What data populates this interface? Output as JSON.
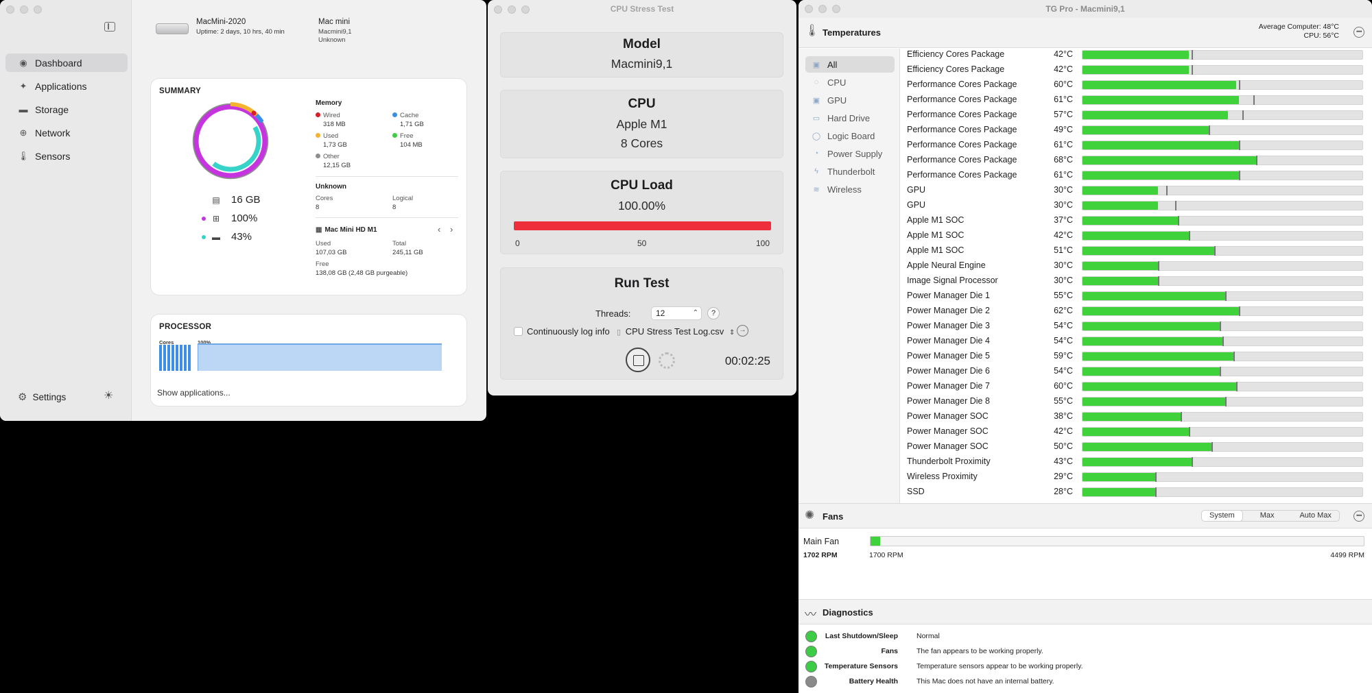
{
  "monitor": {
    "sidebar": {
      "items": [
        {
          "label": "Dashboard",
          "icon": "dashboard-icon",
          "selected": true
        },
        {
          "label": "Applications",
          "icon": "applications-icon",
          "selected": false
        },
        {
          "label": "Storage",
          "icon": "storage-icon",
          "selected": false
        },
        {
          "label": "Network",
          "icon": "network-icon",
          "selected": false
        },
        {
          "label": "Sensors",
          "icon": "sensors-icon",
          "selected": false
        }
      ],
      "settings_label": "Settings"
    },
    "device": {
      "name": "MacMini-2020",
      "uptime": "Uptime: 2 days, 10 hrs, 40 min",
      "model": "Mac mini",
      "identifier": "Macmini9,1",
      "extra": "Unknown"
    },
    "summary": {
      "title": "SUMMARY",
      "memory_title": "Memory",
      "memory": {
        "wired": {
          "label": "Wired",
          "value": "318 MB",
          "color": "#d81f26"
        },
        "cache": {
          "label": "Cache",
          "value": "1,71 GB",
          "color": "#3a8ee6"
        },
        "used": {
          "label": "Used",
          "value": "1,73 GB",
          "color": "#f2b431"
        },
        "free": {
          "label": "Free",
          "value": "104 MB",
          "color": "#3ccc45"
        },
        "other": {
          "label": "Other",
          "value": "12,15 GB",
          "color": "#8e8e8e"
        }
      },
      "cpu_title": "Unknown",
      "cores_label": "Cores",
      "cores_value": "8",
      "logical_label": "Logical",
      "logical_value": "8",
      "disk_title": "Mac Mini HD M1",
      "disk_used_label": "Used",
      "disk_used": "107,03 GB",
      "disk_total_label": "Total",
      "disk_total": "245,11 GB",
      "disk_free_label": "Free",
      "disk_free": "138,08 GB (2,48 GB purgeable)",
      "stat_memory": "16 GB",
      "stat_cpu": "100%",
      "stat_disk": "43%",
      "colors": {
        "cpu": "#c634e0",
        "disk": "#36d3c8"
      }
    },
    "processor": {
      "title": "PROCESSOR",
      "cores_label": "Cores",
      "percent_label": "100%",
      "show_apps": "Show applications..."
    }
  },
  "stress": {
    "title": "CPU Stress Test",
    "model_title": "Model",
    "model_value": "Macmini9,1",
    "cpu_title": "CPU",
    "cpu_value": "Apple M1",
    "cpu_cores": "8 Cores",
    "load_title": "CPU Load",
    "load_value": "100.00%",
    "load_fraction": 1.0,
    "load_color": "#ee2f3b",
    "ticks": [
      "0",
      "50",
      "100"
    ],
    "run_title": "Run Test",
    "threads_label": "Threads:",
    "threads_value": "12",
    "help_label": "?",
    "log_label": "Continuously log info",
    "log_file": "CPU Stress Test Log.csv",
    "timer": "00:02:25"
  },
  "tgpro": {
    "title": "TG Pro - Macmini9,1",
    "temps_title": "Temperatures",
    "avg_label": "Average Computer:",
    "avg_value": "48°C",
    "cpu_label": "CPU:",
    "cpu_value": "56°C",
    "categories": [
      {
        "label": "All",
        "icon": "all-icon"
      },
      {
        "label": "CPU",
        "icon": "cpu-icon"
      },
      {
        "label": "GPU",
        "icon": "gpu-icon"
      },
      {
        "label": "Hard Drive",
        "icon": "hard-drive-icon"
      },
      {
        "label": "Logic Board",
        "icon": "logic-board-icon"
      },
      {
        "label": "Power Supply",
        "icon": "power-supply-icon"
      },
      {
        "label": "Thunderbolt",
        "icon": "thunderbolt-icon"
      },
      {
        "label": "Wireless",
        "icon": "wireless-icon"
      }
    ],
    "sensors": [
      {
        "name": "Efficiency Cores Package",
        "temp": "42°C",
        "level": 0.38,
        "max": 0.39
      },
      {
        "name": "Efficiency Cores Package",
        "temp": "42°C",
        "level": 0.38,
        "max": 0.39
      },
      {
        "name": "Performance Cores Package",
        "temp": "60°C",
        "level": 0.55,
        "max": 0.56
      },
      {
        "name": "Performance Cores Package",
        "temp": "61°C",
        "level": 0.56,
        "max": 0.61
      },
      {
        "name": "Performance Cores Package",
        "temp": "57°C",
        "level": 0.52,
        "max": 0.57
      },
      {
        "name": "Performance Cores Package",
        "temp": "49°C",
        "level": 0.45,
        "max": 0.45
      },
      {
        "name": "Performance Cores Package",
        "temp": "61°C",
        "level": 0.56,
        "max": 0.56
      },
      {
        "name": "Performance Cores Package",
        "temp": "68°C",
        "level": 0.62,
        "max": 0.62
      },
      {
        "name": "Performance Cores Package",
        "temp": "61°C",
        "level": 0.56,
        "max": 0.56
      },
      {
        "name": "GPU",
        "temp": "30°C",
        "level": 0.27,
        "max": 0.3
      },
      {
        "name": "GPU",
        "temp": "30°C",
        "level": 0.27,
        "max": 0.33
      },
      {
        "name": "Apple M1 SOC",
        "temp": "37°C",
        "level": 0.34,
        "max": 0.34
      },
      {
        "name": "Apple M1 SOC",
        "temp": "42°C",
        "level": 0.38,
        "max": 0.38
      },
      {
        "name": "Apple M1 SOC",
        "temp": "51°C",
        "level": 0.47,
        "max": 0.47
      },
      {
        "name": "Apple Neural Engine",
        "temp": "30°C",
        "level": 0.27,
        "max": 0.27
      },
      {
        "name": "Image Signal Processor",
        "temp": "30°C",
        "level": 0.27,
        "max": 0.27
      },
      {
        "name": "Power Manager Die 1",
        "temp": "55°C",
        "level": 0.51,
        "max": 0.51
      },
      {
        "name": "Power Manager Die 2",
        "temp": "62°C",
        "level": 0.56,
        "max": 0.56
      },
      {
        "name": "Power Manager Die 3",
        "temp": "54°C",
        "level": 0.49,
        "max": 0.49
      },
      {
        "name": "Power Manager Die 4",
        "temp": "54°C",
        "level": 0.5,
        "max": 0.5
      },
      {
        "name": "Power Manager Die 5",
        "temp": "59°C",
        "level": 0.54,
        "max": 0.54
      },
      {
        "name": "Power Manager Die 6",
        "temp": "54°C",
        "level": 0.49,
        "max": 0.49
      },
      {
        "name": "Power Manager Die 7",
        "temp": "60°C",
        "level": 0.55,
        "max": 0.55
      },
      {
        "name": "Power Manager Die 8",
        "temp": "55°C",
        "level": 0.51,
        "max": 0.51
      },
      {
        "name": "Power Manager SOC",
        "temp": "38°C",
        "level": 0.35,
        "max": 0.35
      },
      {
        "name": "Power Manager SOC",
        "temp": "42°C",
        "level": 0.38,
        "max": 0.38
      },
      {
        "name": "Power Manager SOC",
        "temp": "50°C",
        "level": 0.46,
        "max": 0.46
      },
      {
        "name": "Thunderbolt Proximity",
        "temp": "43°C",
        "level": 0.39,
        "max": 0.39
      },
      {
        "name": "Wireless Proximity",
        "temp": "29°C",
        "level": 0.26,
        "max": 0.26
      },
      {
        "name": "SSD",
        "temp": "28°C",
        "level": 0.26,
        "max": 0.26
      }
    ],
    "fans_title": "Fans",
    "fan_modes": [
      "System",
      "Max",
      "Auto Max"
    ],
    "fan_mode_selected": "System",
    "fan": {
      "name": "Main Fan",
      "current": "1702 RPM",
      "min": "1700 RPM",
      "max": "4499 RPM",
      "level": 0.001
    },
    "diag_title": "Diagnostics",
    "diagnostics": [
      {
        "label": "Last Shutdown/Sleep",
        "value": "Normal",
        "color": "#3ccc45"
      },
      {
        "label": "Fans",
        "value": "The fan appears to be working properly.",
        "color": "#3ccc45"
      },
      {
        "label": "Temperature Sensors",
        "value": "Temperature sensors appear to be working properly.",
        "color": "#3ccc45"
      },
      {
        "label": "Battery Health",
        "value": "This Mac does not have an internal battery.",
        "color": "#8a8a8a"
      }
    ],
    "bar_color": "#3fd23a"
  }
}
